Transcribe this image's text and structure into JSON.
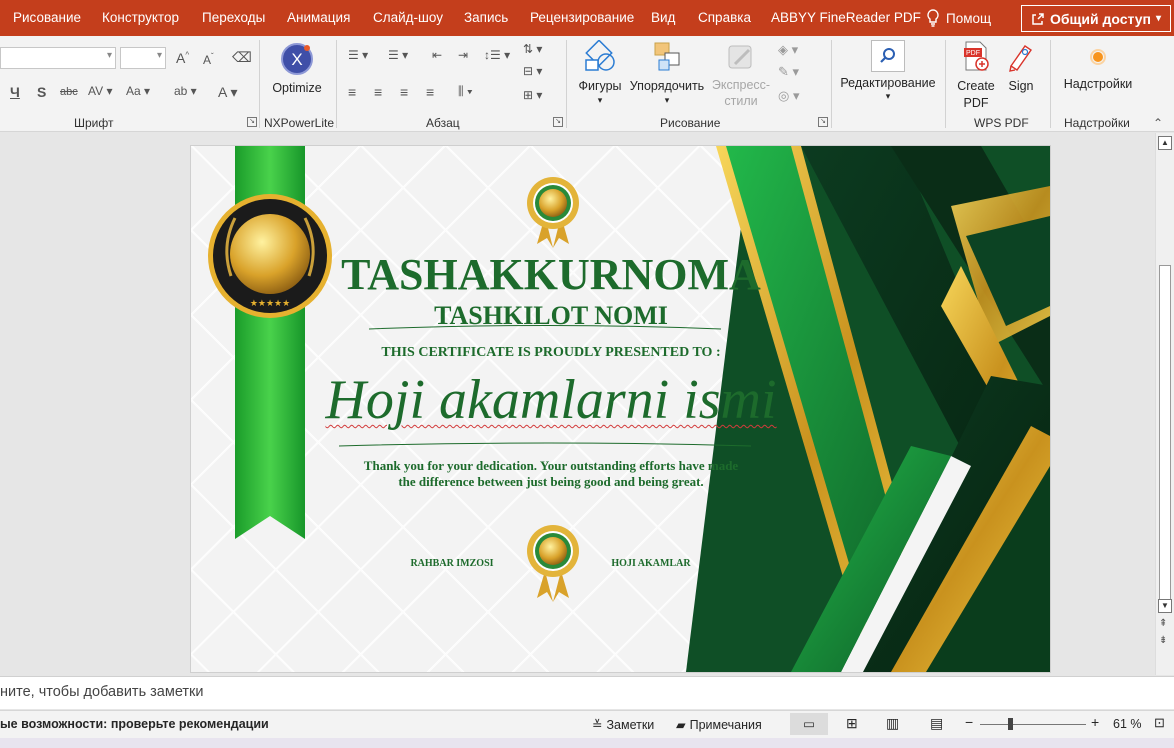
{
  "menu": {
    "tabs": [
      "Рисование",
      "Конструктор",
      "Переходы",
      "Анимация",
      "Слайд-шоу",
      "Запись",
      "Рецензирование",
      "Вид",
      "Справка",
      "ABBYY FineReader PDF"
    ],
    "tell_me": "Помощ",
    "share": "Общий доступ"
  },
  "ribbon": {
    "groups": {
      "font": "Шрифт",
      "nxpowerlite": "NXPowerLite",
      "paragraph": "Абзац",
      "drawing": "Рисование",
      "wps_pdf": "WPS PDF",
      "addins": "Надстройки"
    },
    "buttons": {
      "optimize": "Optimize",
      "shapes": "Фигуры",
      "arrange": "Упорядочить",
      "quick_styles": "Экспресс-\nстили",
      "editing": "Редактирование",
      "create_pdf": "Create\nPDF",
      "sign": "Sign",
      "addins": "Надстройки"
    }
  },
  "slide": {
    "title": "TASHAKKURNOMA",
    "org": "TASHKILOT NOMI",
    "presented": "THIS CERTIFICATE IS PROUDLY PRESENTED TO :",
    "recipient": "Hoji akamlarni ismi",
    "message_line1": "Thank you for your dedication. Your outstanding efforts have made",
    "message_line2": "the difference between just being good and being great.",
    "sign_left": "RAHBAR IMZOSI",
    "sign_right": "HOJI AKAMLAR",
    "colors": {
      "green": "#1d6b2c",
      "dark_green": "#0b3a1e",
      "gold": "#e0b22c",
      "ribbon_green": "#2fbf3a"
    }
  },
  "notes": {
    "placeholder": "ните, чтобы добавить заметки"
  },
  "status": {
    "accessibility": "ые возможности: проверьте рекомендации",
    "notes_btn": "Заметки",
    "comments_btn": "Примечания",
    "zoom": "61 %"
  }
}
